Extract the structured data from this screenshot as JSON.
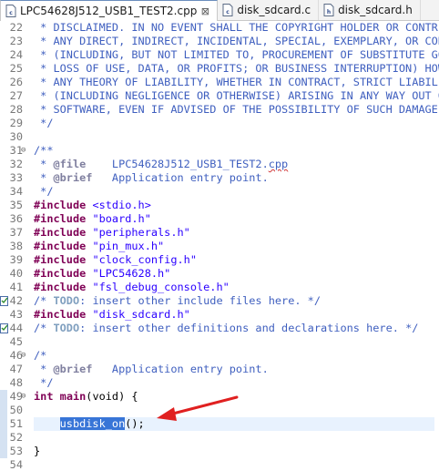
{
  "tabs": [
    {
      "label": "LPC54628J512_USB1_TEST2.cpp",
      "active": true,
      "icon": "cpp-file-icon",
      "close": "⊠"
    },
    {
      "label": "disk_sdcard.c",
      "active": false,
      "icon": "c-file-icon"
    },
    {
      "label": "disk_sdcard.h",
      "active": false,
      "icon": "h-file-icon"
    }
  ],
  "editor": {
    "lines": [
      {
        "n": "22",
        "segments": [
          {
            "t": " * DISCLAIMED. IN NO EVENT SHALL THE COPYRIGHT HOLDER OR CONTRIBUTORS",
            "c": "comment"
          }
        ]
      },
      {
        "n": "23",
        "segments": [
          {
            "t": " * ANY DIRECT, INDIRECT, INCIDENTAL, SPECIAL, EXEMPLARY, OR CONSEQUENTIAL",
            "c": "comment"
          }
        ]
      },
      {
        "n": "24",
        "segments": [
          {
            "t": " * (INCLUDING, BUT NOT LIMITED TO, PROCUREMENT OF SUBSTITUTE GOODS OR",
            "c": "comment"
          }
        ]
      },
      {
        "n": "25",
        "segments": [
          {
            "t": " * LOSS OF USE, DATA, OR PROFITS; OR BUSINESS INTERRUPTION) HOWEVER",
            "c": "comment"
          }
        ]
      },
      {
        "n": "26",
        "segments": [
          {
            "t": " * ANY THEORY OF LIABILITY, WHETHER IN CONTRACT, STRICT LIABILITY, OR",
            "c": "comment"
          }
        ]
      },
      {
        "n": "27",
        "segments": [
          {
            "t": " * (INCLUDING NEGLIGENCE OR OTHERWISE) ARISING IN ANY WAY OUT OF THE",
            "c": "comment"
          }
        ]
      },
      {
        "n": "28",
        "segments": [
          {
            "t": " * SOFTWARE, EVEN IF ADVISED OF THE POSSIBILITY OF SUCH DAMAGE.",
            "c": "comment"
          }
        ]
      },
      {
        "n": "29",
        "segments": [
          {
            "t": " */",
            "c": "comment"
          }
        ]
      },
      {
        "n": "30",
        "segments": []
      },
      {
        "n": "31",
        "fold": "⊖",
        "segments": [
          {
            "t": "/**",
            "c": "comment"
          }
        ]
      },
      {
        "n": "32",
        "segments": [
          {
            "t": " * ",
            "c": "comment"
          },
          {
            "t": "@file",
            "c": "tag"
          },
          {
            "t": "    LPC54628J512_USB1_TEST2.",
            "c": "comment"
          },
          {
            "t": "cpp",
            "c": "comment squiggle"
          }
        ]
      },
      {
        "n": "33",
        "segments": [
          {
            "t": " * ",
            "c": "comment"
          },
          {
            "t": "@brief",
            "c": "tag"
          },
          {
            "t": "   Application entry point.",
            "c": "comment"
          }
        ]
      },
      {
        "n": "34",
        "segments": [
          {
            "t": " */",
            "c": "comment"
          }
        ]
      },
      {
        "n": "35",
        "segments": [
          {
            "t": "#include",
            "c": "kw"
          },
          {
            "t": " <stdio.h>",
            "c": "str"
          }
        ]
      },
      {
        "n": "36",
        "segments": [
          {
            "t": "#include",
            "c": "kw"
          },
          {
            "t": " \"board.h\"",
            "c": "str"
          }
        ]
      },
      {
        "n": "37",
        "segments": [
          {
            "t": "#include",
            "c": "kw"
          },
          {
            "t": " \"peripherals.h\"",
            "c": "str"
          }
        ]
      },
      {
        "n": "38",
        "segments": [
          {
            "t": "#include",
            "c": "kw"
          },
          {
            "t": " \"pin_mux.h\"",
            "c": "str"
          }
        ]
      },
      {
        "n": "39",
        "segments": [
          {
            "t": "#include",
            "c": "kw"
          },
          {
            "t": " \"clock_config.h\"",
            "c": "str"
          }
        ]
      },
      {
        "n": "40",
        "segments": [
          {
            "t": "#include",
            "c": "kw"
          },
          {
            "t": " \"LPC54628.h\"",
            "c": "str"
          }
        ]
      },
      {
        "n": "41",
        "segments": [
          {
            "t": "#include",
            "c": "kw"
          },
          {
            "t": " \"fsl_debug_console.h\"",
            "c": "str"
          }
        ]
      },
      {
        "n": "42",
        "task": true,
        "segments": [
          {
            "t": "/* ",
            "c": "comment"
          },
          {
            "t": "TODO",
            "c": "todo"
          },
          {
            "t": ": insert other include files here. */",
            "c": "comment"
          }
        ]
      },
      {
        "n": "43",
        "segments": [
          {
            "t": "#include",
            "c": "kw"
          },
          {
            "t": " \"disk_sdcard.h\"",
            "c": "str"
          }
        ]
      },
      {
        "n": "44",
        "task": true,
        "segments": [
          {
            "t": "/* ",
            "c": "comment"
          },
          {
            "t": "TODO",
            "c": "todo"
          },
          {
            "t": ": insert other definitions and declarations here. */",
            "c": "comment"
          }
        ]
      },
      {
        "n": "45",
        "segments": []
      },
      {
        "n": "46",
        "fold": "⊖",
        "segments": [
          {
            "t": "/*",
            "c": "comment"
          }
        ]
      },
      {
        "n": "47",
        "segments": [
          {
            "t": " * ",
            "c": "comment"
          },
          {
            "t": "@brief",
            "c": "tag"
          },
          {
            "t": "   Application entry point.",
            "c": "comment"
          }
        ]
      },
      {
        "n": "48",
        "segments": [
          {
            "t": " */",
            "c": "comment"
          }
        ]
      },
      {
        "n": "49",
        "fold": "⊖",
        "segments": [
          {
            "t": "int",
            "c": "kw"
          },
          {
            "t": " ",
            "c": ""
          },
          {
            "t": "main",
            "c": "kw"
          },
          {
            "t": "(void) {",
            "c": ""
          }
        ]
      },
      {
        "n": "50",
        "segments": []
      },
      {
        "n": "51",
        "segments": [
          {
            "t": "    ",
            "c": ""
          },
          {
            "t": "usbdisk_on",
            "c": "selected-call"
          },
          {
            "t": "();",
            "c": ""
          }
        ]
      },
      {
        "n": "52",
        "segments": []
      },
      {
        "n": "53",
        "segments": [
          {
            "t": "}",
            "c": ""
          }
        ]
      },
      {
        "n": "54",
        "segments": []
      }
    ]
  },
  "annotation": {
    "color": "#e02020",
    "icon": "red-arrow"
  }
}
